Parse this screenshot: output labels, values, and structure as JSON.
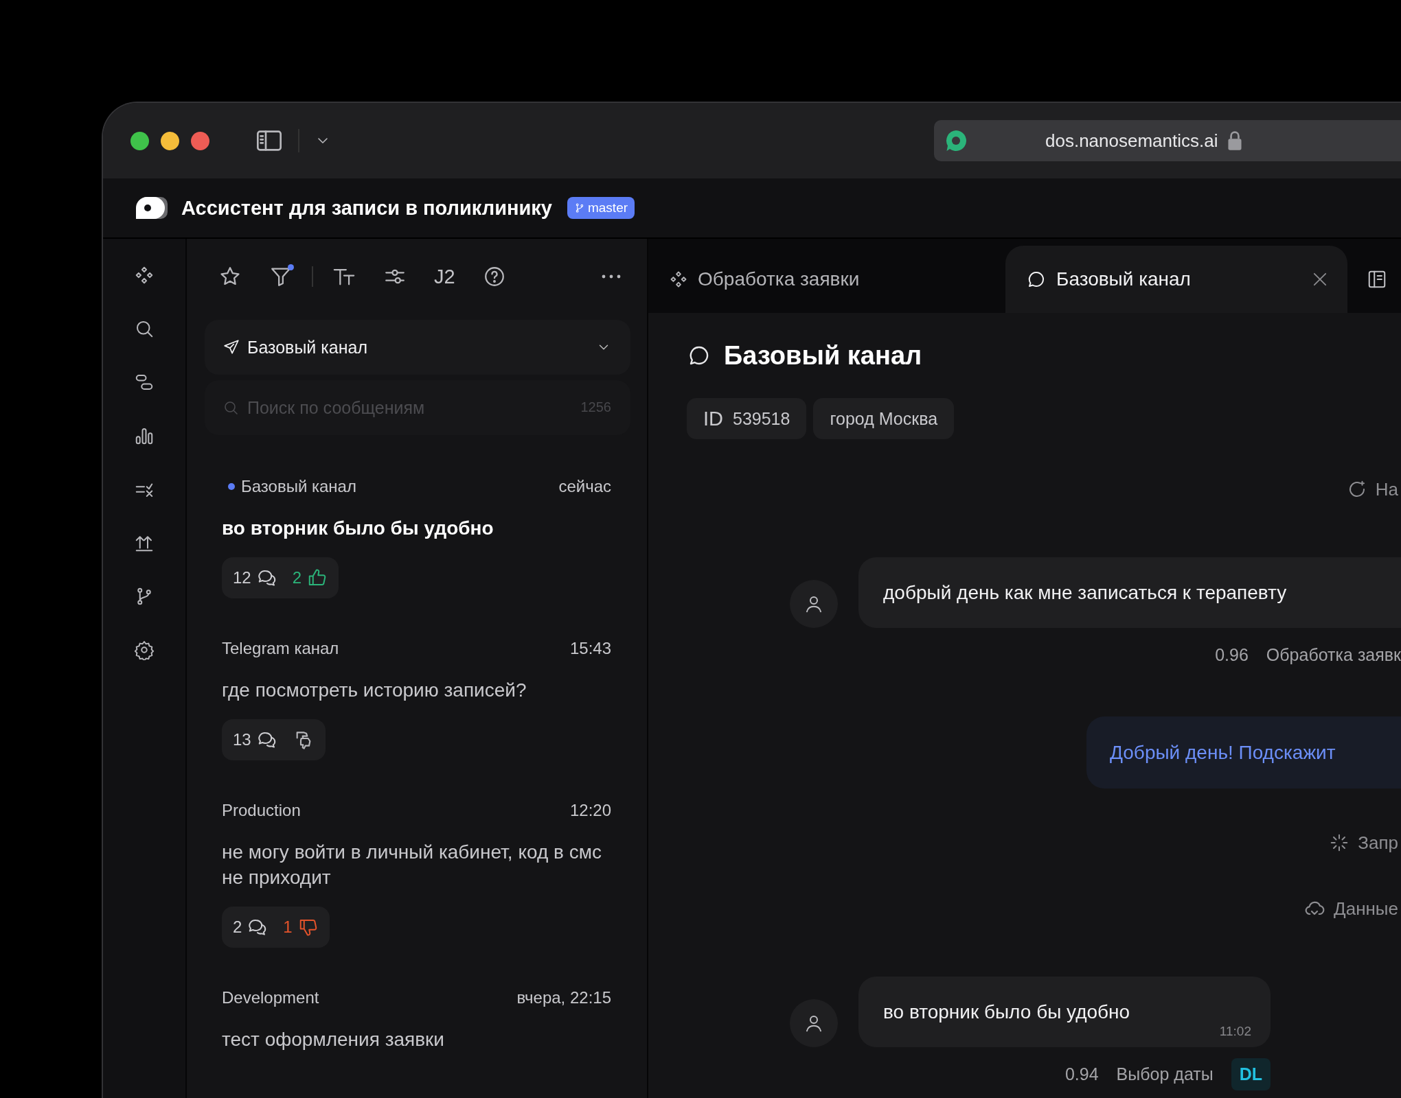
{
  "browser": {
    "url": "dos.nanosemantics.ai"
  },
  "app": {
    "title": "Ассистент для записи в поликлинику",
    "branch": "master"
  },
  "toolbar": {
    "filter_active": true,
    "version": "J2"
  },
  "channel_select": {
    "value": "Базовый канал"
  },
  "search": {
    "placeholder": "Поиск по сообщениям",
    "count": "1256"
  },
  "conversations": [
    {
      "channel": "Базовый канал",
      "time": "сейчас",
      "unread": true,
      "message": "во вторник было бы удобно",
      "comments": "12",
      "reaction": {
        "kind": "like",
        "count": "2"
      }
    },
    {
      "channel": "Telegram канал",
      "time": "15:43",
      "unread": false,
      "message": "где посмотреть историю записей?",
      "comments": "13",
      "reaction": {
        "kind": "mixed"
      }
    },
    {
      "channel": "Production",
      "time": "12:20",
      "unread": false,
      "message": "не могу войти в личный кабинет, код в смс не приходит",
      "comments": "2",
      "reaction": {
        "kind": "dislike",
        "count": "1"
      }
    },
    {
      "channel": "Development",
      "time": "вчера, 22:15",
      "unread": false,
      "message": "тест оформления заявки"
    }
  ],
  "tabs": [
    {
      "label": "Обработка заявки",
      "kind": "flow",
      "selected": false
    },
    {
      "label": "Базовый канал",
      "kind": "chat",
      "selected": true
    }
  ],
  "dialog": {
    "title": "Базовый канал",
    "chips": [
      {
        "label": "ID",
        "value": "539518"
      },
      {
        "value": "город Москва"
      }
    ],
    "items": [
      {
        "kind": "restart",
        "text": "На"
      },
      {
        "kind": "user",
        "text": "добрый день как мне записаться к терапевту",
        "score": "0.96",
        "intent": "Обработка заявк"
      },
      {
        "kind": "bot",
        "text": "Добрый день! Подскажит"
      },
      {
        "kind": "loading",
        "text": "Запр"
      },
      {
        "kind": "data",
        "text": "Данные"
      },
      {
        "kind": "user",
        "text": "во вторник было бы удобно",
        "time": "11:02",
        "score": "0.94",
        "intent": "Выбор даты",
        "tag": "DL"
      }
    ]
  }
}
